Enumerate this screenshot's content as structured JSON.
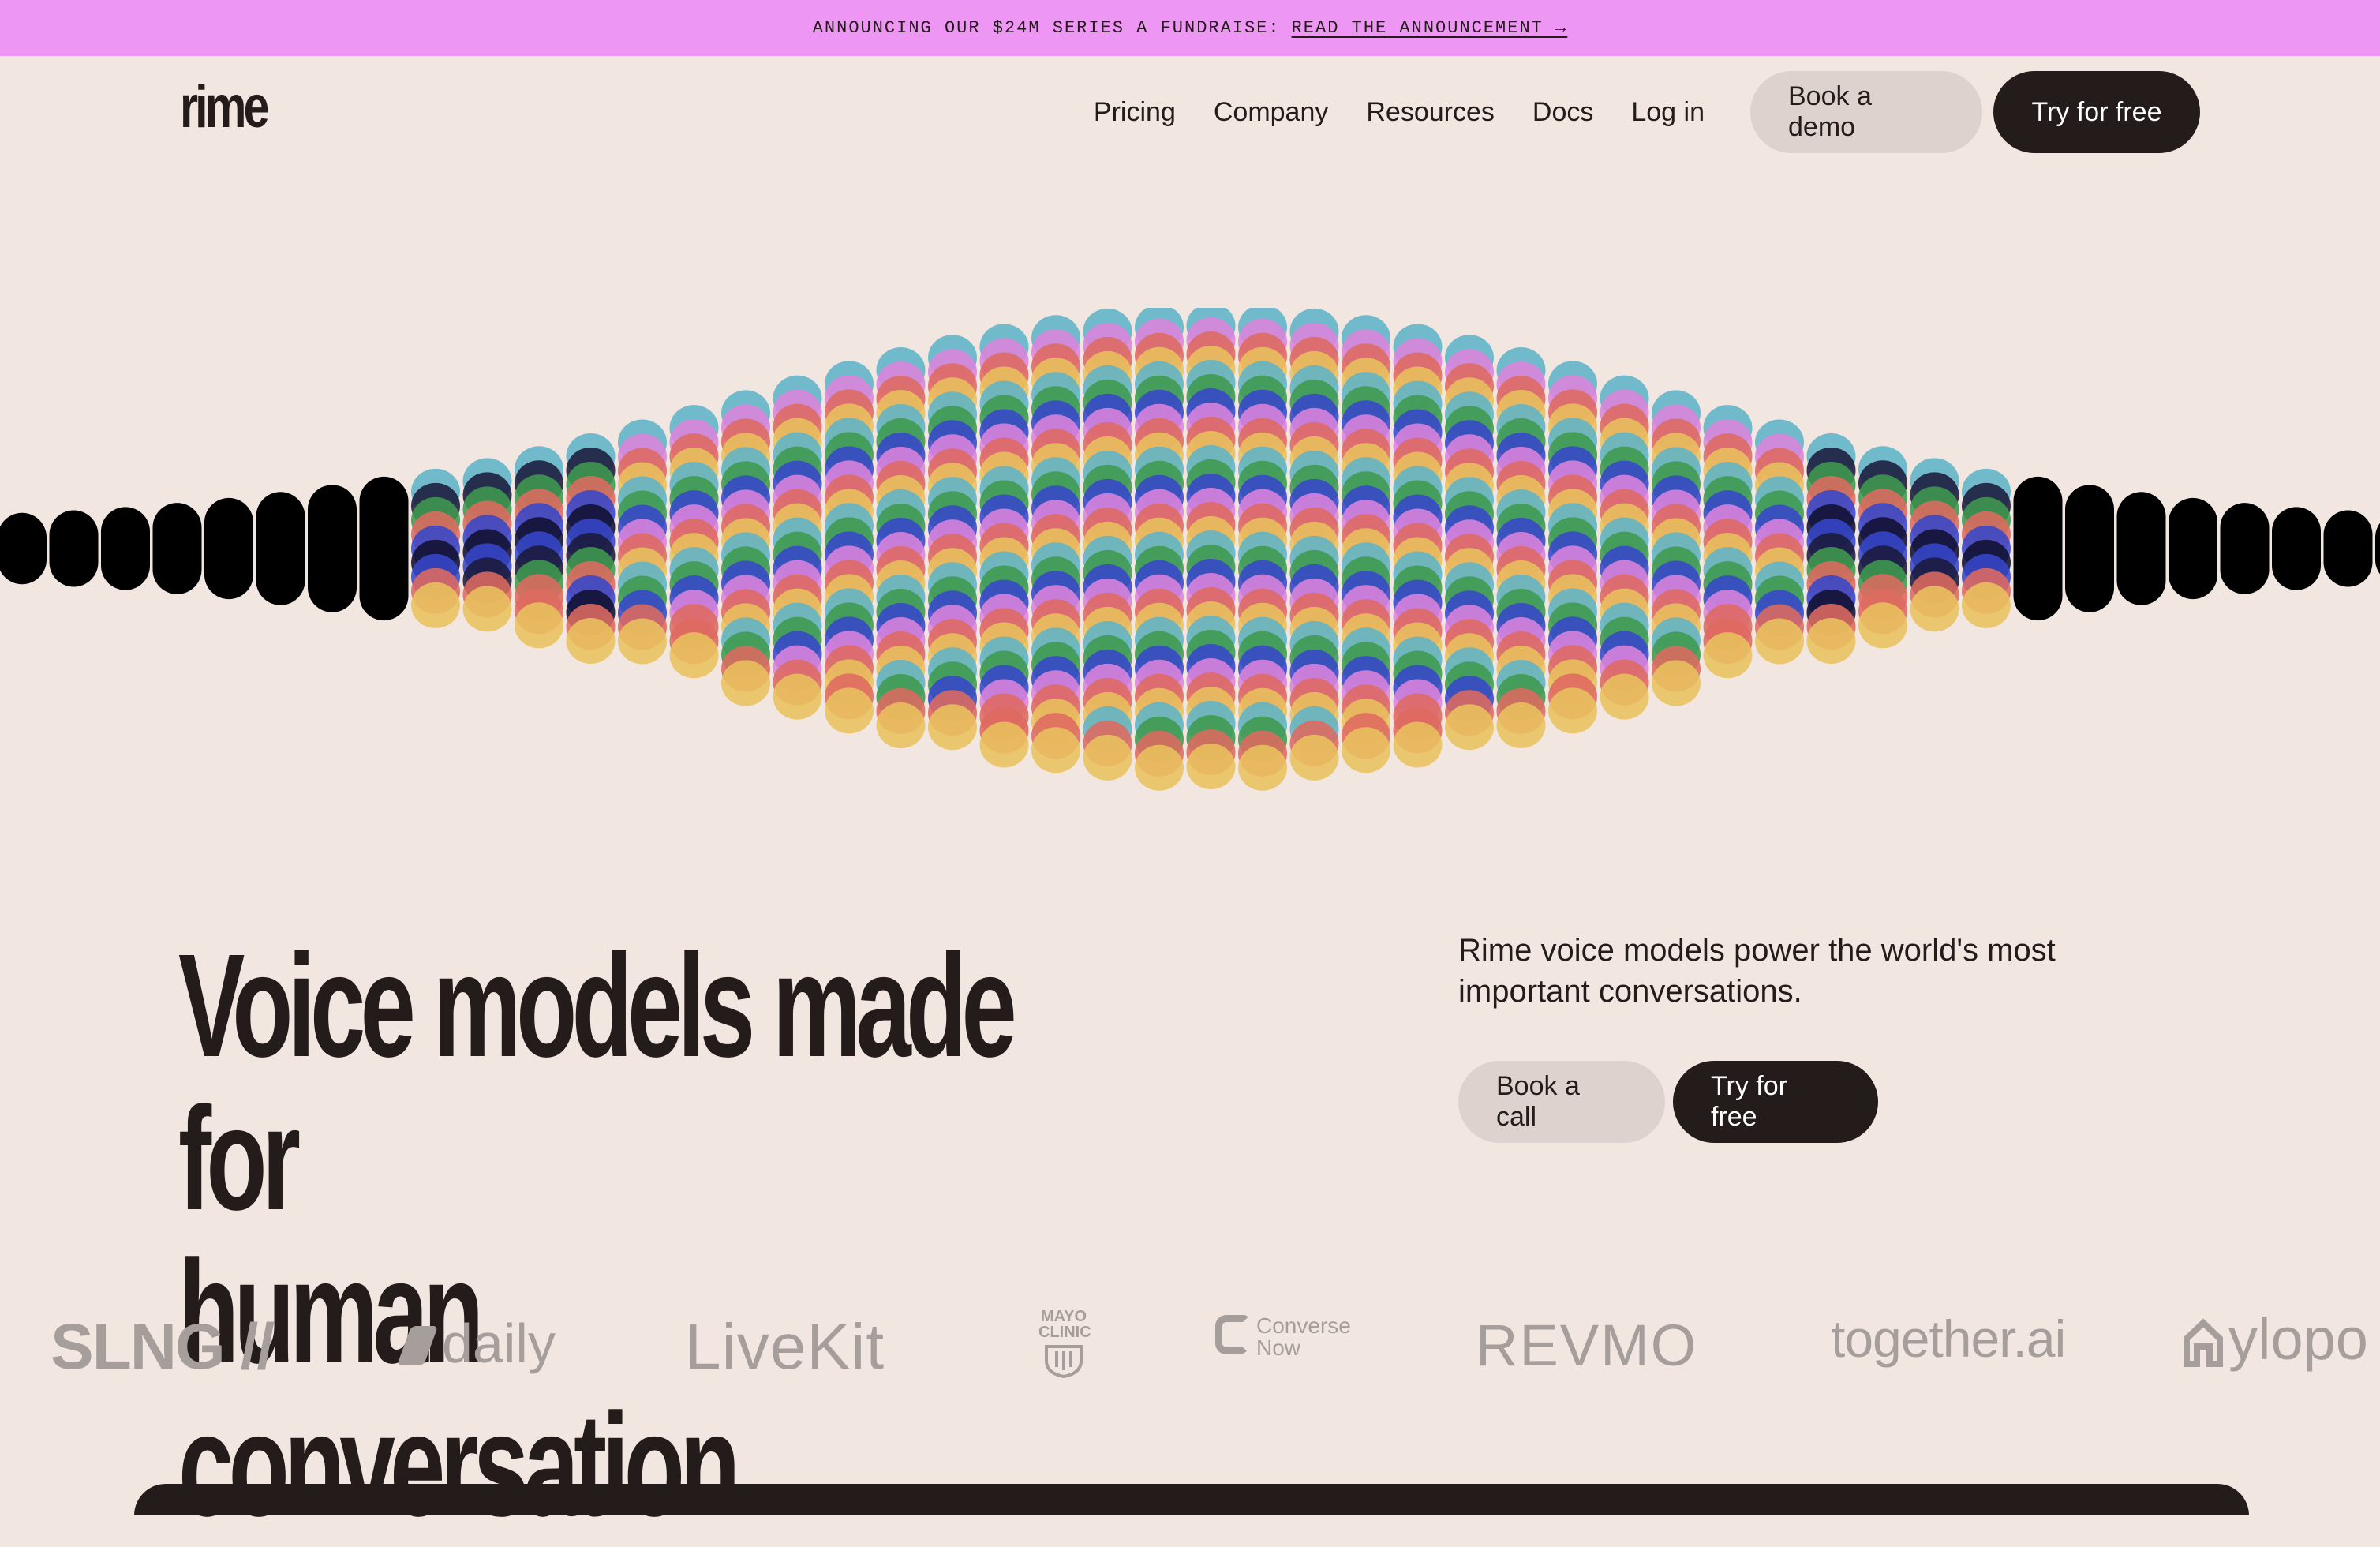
{
  "banner": {
    "text": "ANNOUNCING OUR $24M SERIES A FUNDRAISE:",
    "link": "READ THE ANNOUNCEMENT →"
  },
  "header": {
    "logo": "rime",
    "nav": [
      "Pricing",
      "Company",
      "Resources",
      "Docs",
      "Log in"
    ],
    "book_demo": "Book a demo",
    "try_free": "Try for free"
  },
  "hero": {
    "headline_line1": "Voice models made for",
    "headline_line2": "human conversation",
    "subtitle": "Rime voice models power the world's most important conversations.",
    "book_call": "Book a call",
    "try_free": "Try for free"
  },
  "logos": {
    "slng": "SLNG //",
    "daily": "daily",
    "livekit": "LiveKit",
    "mayo_line1": "MAYO",
    "mayo_line2": "CLINIC",
    "converse_line1": "Converse",
    "converse_line2": "Now",
    "revmo": "REVMO",
    "together": "together.ai",
    "ylopo": "ylopo"
  },
  "colors": {
    "background": "#f1e7e0",
    "banner": "#ee96f4",
    "dark": "#231c1a",
    "light_button": "#ddd2ce",
    "logo_gray": "#a59e9a",
    "wave": [
      "#5fb4c8",
      "#3747c9",
      "#dc84dc",
      "#de6a60",
      "#e8c15d",
      "#3f9a4f"
    ]
  }
}
